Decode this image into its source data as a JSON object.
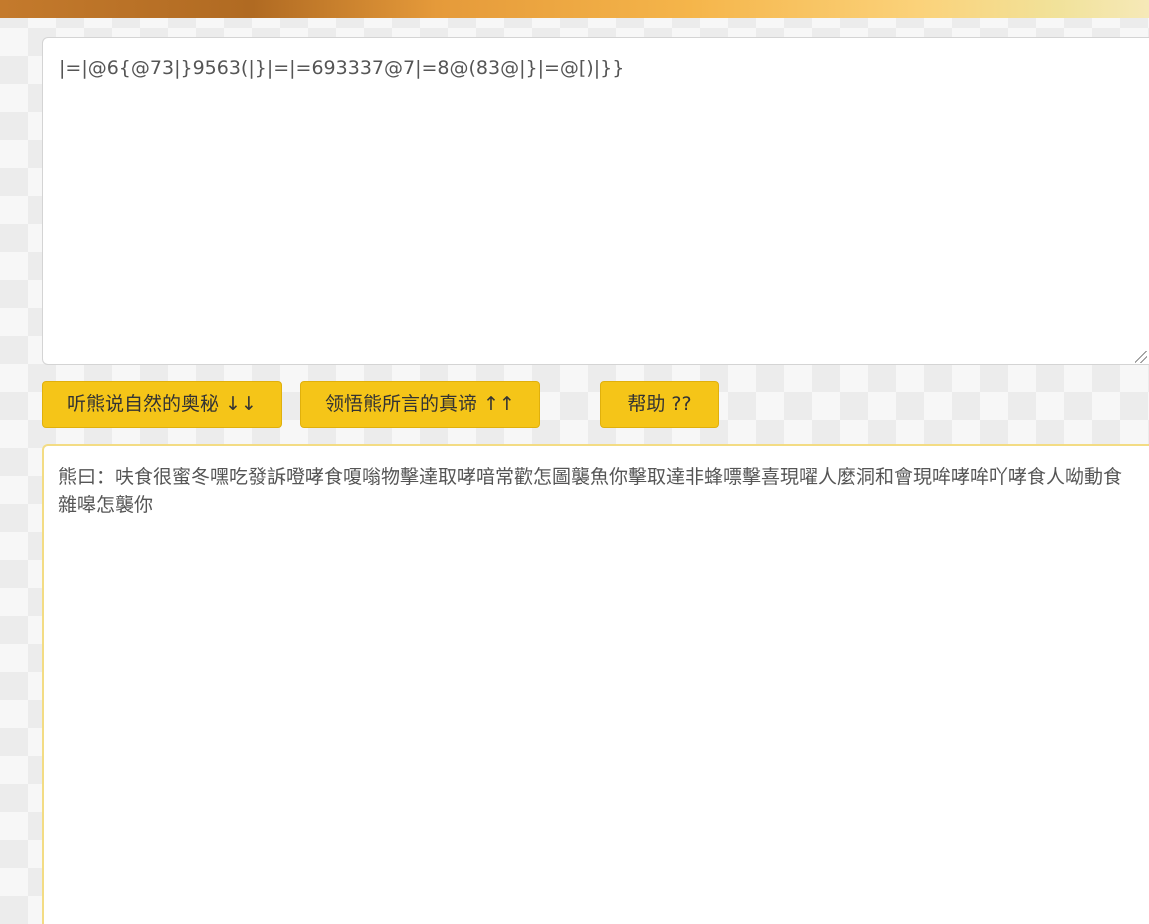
{
  "input": {
    "value": "|=|@6{@73|}9563(|}|=|=693337@7|=8@(83@|}|=@[)|}}"
  },
  "buttons": {
    "encode_label": "听熊说自然的奥秘 ↓↓",
    "decode_label": "领悟熊所言的真谛 ↑↑",
    "help_label": "帮助 ??"
  },
  "output": {
    "value": "熊曰：呋食很蜜冬嘿吃發訴噔哮食嗄嗡物擊達取哮喑常歡怎圖襲魚你擊取達非蜂嘌擊喜現嚁人麼洞和會現哞哮哞吖哮食人呦動食雜嗥怎襲你"
  },
  "colors": {
    "button": "#f5c518",
    "output_border": "#f3dc84"
  }
}
